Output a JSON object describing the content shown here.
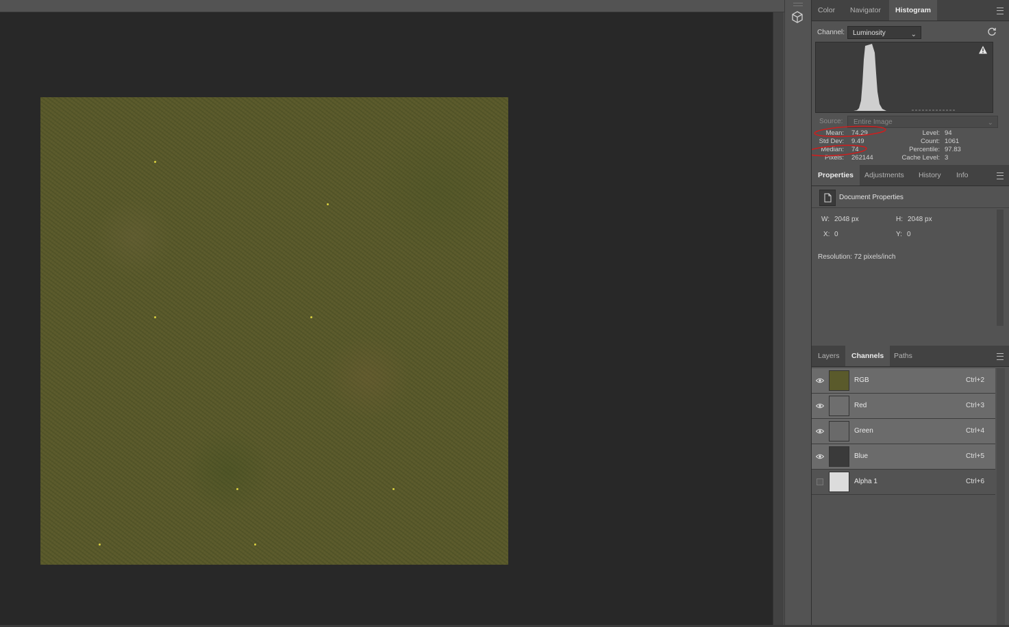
{
  "histogram_panel": {
    "tabs": [
      {
        "label": "Color",
        "active": false
      },
      {
        "label": "Navigator",
        "active": false
      },
      {
        "label": "Histogram",
        "active": true
      }
    ],
    "channel_label": "Channel:",
    "channel_value": "Luminosity",
    "source_label": "Source:",
    "source_value": "Entire Image",
    "stats_left": [
      {
        "label": "Mean:",
        "value": "74.29"
      },
      {
        "label": "Std Dev:",
        "value": "9.49"
      },
      {
        "label": "Median:",
        "value": "74"
      },
      {
        "label": "Pixels:",
        "value": "262144"
      }
    ],
    "stats_right": [
      {
        "label": "Level:",
        "value": "94"
      },
      {
        "label": "Count:",
        "value": "1061"
      },
      {
        "label": "Percentile:",
        "value": "97.83"
      },
      {
        "label": "Cache Level:",
        "value": "3"
      }
    ],
    "highlight_color": "#cc1f1f"
  },
  "properties_panel": {
    "tabs": [
      {
        "label": "Properties",
        "active": true
      },
      {
        "label": "Adjustments",
        "active": false
      },
      {
        "label": "History",
        "active": false
      },
      {
        "label": "Info",
        "active": false
      }
    ],
    "title": "Document Properties",
    "w_label": "W:",
    "w_value": "2048 px",
    "h_label": "H:",
    "h_value": "2048 px",
    "x_label": "X:",
    "x_value": "0",
    "y_label": "Y:",
    "y_value": "0",
    "resolution": "Resolution: 72 pixels/inch"
  },
  "channels_panel": {
    "tabs": [
      {
        "label": "Layers",
        "active": false
      },
      {
        "label": "Channels",
        "active": true
      },
      {
        "label": "Paths",
        "active": false
      }
    ],
    "channels": [
      {
        "name": "RGB",
        "shortcut": "Ctrl+2",
        "visible": true,
        "thumb_color": "#5a5a2b"
      },
      {
        "name": "Red",
        "shortcut": "Ctrl+3",
        "visible": true,
        "thumb_color": "#6e6e6e"
      },
      {
        "name": "Green",
        "shortcut": "Ctrl+4",
        "visible": true,
        "thumb_color": "#6a6a6a"
      },
      {
        "name": "Blue",
        "shortcut": "Ctrl+5",
        "visible": true,
        "thumb_color": "#3a3a3a"
      },
      {
        "name": "Alpha 1",
        "shortcut": "Ctrl+6",
        "visible": false,
        "thumb_color": "#dcdcdc"
      }
    ]
  },
  "icons": {
    "mini_panel": "3d-cube-icon",
    "refresh": "refresh-icon",
    "warning": "warning-triangle-icon",
    "document": "document-icon",
    "eye": "eye-icon",
    "panel_menu": "panel-menu-icon"
  }
}
